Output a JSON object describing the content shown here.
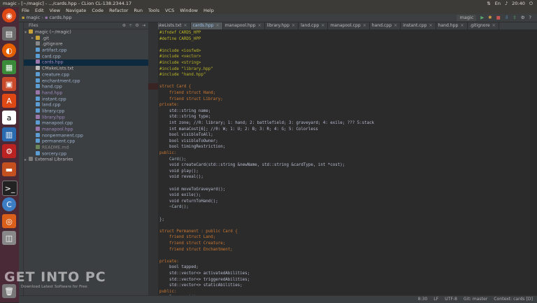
{
  "window_title": "magic - [~/magic] - .../cards.hpp - CLion CL-138.2344.17",
  "tray": {
    "clock": "20:40"
  },
  "menu": [
    "File",
    "Edit",
    "View",
    "Navigate",
    "Code",
    "Refactor",
    "Run",
    "Tools",
    "VCS",
    "Window",
    "Help"
  ],
  "breadcrumbs": {
    "project": "magic",
    "file": "cards.hpp"
  },
  "run_config": "magic",
  "project_panel": {
    "title": "Files"
  },
  "tree": [
    {
      "label": "magic (~/magic)",
      "indent": 0,
      "kind": "folder"
    },
    {
      "label": ".git",
      "indent": 1,
      "kind": "folder"
    },
    {
      "label": ".gitignore",
      "indent": 1,
      "kind": "file"
    },
    {
      "label": "artifact.cpp",
      "indent": 1,
      "kind": "cpp"
    },
    {
      "label": "card.cpp",
      "indent": 1,
      "kind": "cpp"
    },
    {
      "label": "cards.hpp",
      "indent": 1,
      "kind": "hpp",
      "selected": true
    },
    {
      "label": "CMakeLists.txt",
      "indent": 1,
      "kind": "txt"
    },
    {
      "label": "creature.cpp",
      "indent": 1,
      "kind": "cpp"
    },
    {
      "label": "enchantment.cpp",
      "indent": 1,
      "kind": "cpp"
    },
    {
      "label": "hand.cpp",
      "indent": 1,
      "kind": "cpp"
    },
    {
      "label": "hand.hpp",
      "indent": 1,
      "kind": "hpp"
    },
    {
      "label": "instant.cpp",
      "indent": 1,
      "kind": "cpp"
    },
    {
      "label": "land.cpp",
      "indent": 1,
      "kind": "cpp"
    },
    {
      "label": "library.cpp",
      "indent": 1,
      "kind": "cpp"
    },
    {
      "label": "library.hpp",
      "indent": 1,
      "kind": "hpp"
    },
    {
      "label": "manapool.cpp",
      "indent": 1,
      "kind": "cpp"
    },
    {
      "label": "manapool.hpp",
      "indent": 1,
      "kind": "hpp"
    },
    {
      "label": "nonpermanent.cpp",
      "indent": 1,
      "kind": "cpp"
    },
    {
      "label": "permanent.cpp",
      "indent": 1,
      "kind": "cpp"
    },
    {
      "label": "README.md",
      "indent": 1,
      "kind": "md"
    },
    {
      "label": "sorcery.cpp",
      "indent": 1,
      "kind": "cpp"
    },
    {
      "label": "External Libraries",
      "indent": 0,
      "kind": "lib"
    }
  ],
  "tabs": [
    {
      "label": "CMakeLists.txt",
      "active": false
    },
    {
      "label": "cards.hpp",
      "active": true
    },
    {
      "label": "manapool.hpp",
      "active": false
    },
    {
      "label": "library.hpp",
      "active": false
    },
    {
      "label": "land.cpp",
      "active": false
    },
    {
      "label": "manapool.cpp",
      "active": false
    },
    {
      "label": "hand.cpp",
      "active": false
    },
    {
      "label": "instant.cpp",
      "active": false
    },
    {
      "label": "hand.hpp",
      "active": false
    },
    {
      "label": ".gitignore",
      "active": false
    }
  ],
  "code": [
    {
      "t": "#ifndef CARDS_HPP",
      "c": "pp"
    },
    {
      "t": "#define CARDS_HPP",
      "c": "pp"
    },
    {
      "t": "",
      "c": ""
    },
    {
      "t": "#include <iosfwd>",
      "c": "pp"
    },
    {
      "t": "#include <vector>",
      "c": "pp"
    },
    {
      "t": "#include <string>",
      "c": "pp"
    },
    {
      "t": "#include \"library.hpp\"",
      "c": "pp"
    },
    {
      "t": "#include \"hand.hpp\"",
      "c": "pp"
    },
    {
      "t": "",
      "c": ""
    },
    {
      "t": "struct Card {",
      "c": "kw"
    },
    {
      "t": "    friend struct Hand;",
      "c": "kw"
    },
    {
      "t": "    friend struct Library;",
      "c": "kw"
    },
    {
      "t": "private:",
      "c": "kw"
    },
    {
      "t": "    std::string name;",
      "c": "ty"
    },
    {
      "t": "    std::string type;",
      "c": "ty"
    },
    {
      "t": "    int zone; //0: library; 1: hand; 2: battlefield; 3: graveyard; 4: exile; ??? 5:stack",
      "c": "ty"
    },
    {
      "t": "    int manaCost[6]; //0: W; 1: U; 2: B; 3: R; 4: G; 5: Colorless",
      "c": "ty"
    },
    {
      "t": "    bool visibleToAll;",
      "c": "ty"
    },
    {
      "t": "    bool visibleToOwner;",
      "c": "ty"
    },
    {
      "t": "    bool timingRestriction;",
      "c": "ty"
    },
    {
      "t": "public:",
      "c": "kw"
    },
    {
      "t": "    Card();",
      "c": ""
    },
    {
      "t": "    void createCard(std::string &newName, std::string &cardType, int *cost);",
      "c": "ty"
    },
    {
      "t": "    void play();",
      "c": "ty"
    },
    {
      "t": "    void reveal();",
      "c": "ty"
    },
    {
      "t": "",
      "c": ""
    },
    {
      "t": "    void moveToGraveyard();",
      "c": "ty"
    },
    {
      "t": "    void exile();",
      "c": "ty"
    },
    {
      "t": "    void returnToHand();",
      "c": "ty"
    },
    {
      "t": "    ~Card();",
      "c": ""
    },
    {
      "t": "",
      "c": ""
    },
    {
      "t": "};",
      "c": ""
    },
    {
      "t": "",
      "c": ""
    },
    {
      "t": "struct Permanent : public Card {",
      "c": "kw"
    },
    {
      "t": "    friend struct Land;",
      "c": "kw"
    },
    {
      "t": "    friend struct Creature;",
      "c": "kw"
    },
    {
      "t": "    friend struct Enchantment;",
      "c": "kw"
    },
    {
      "t": "",
      "c": ""
    },
    {
      "t": "private:",
      "c": "kw"
    },
    {
      "t": "    bool tapped;",
      "c": "ty"
    },
    {
      "t": "    std::vector<> activatedAbilities;",
      "c": "ty"
    },
    {
      "t": "    std::vector<> triggeredAbilities;",
      "c": "ty"
    },
    {
      "t": "    std::vector<> staticAbilities;",
      "c": "ty"
    },
    {
      "t": "public:",
      "c": "kw"
    },
    {
      "t": "    Permanent();",
      "c": ""
    }
  ],
  "status": {
    "position": "8:30",
    "line_sep": "LF",
    "encoding": "UTF-8",
    "git": "Git: master",
    "context": "Context: cards [D]"
  },
  "watermark": {
    "main": "GET INTO PC",
    "sub": "Download Latest Software for Free"
  },
  "colors": {
    "editor_bg": "#2b2b2b",
    "panel_bg": "#3c3f41",
    "launcher": "#4a2a36",
    "keyword": "#cc7832",
    "string": "#6a8759",
    "preprocessor": "#bbb529"
  }
}
